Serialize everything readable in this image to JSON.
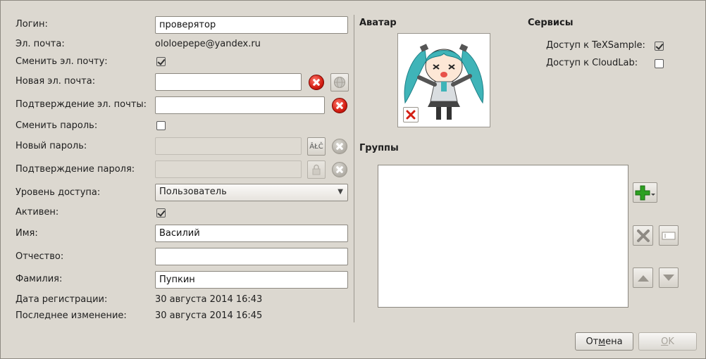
{
  "form": {
    "login": {
      "label": "Логин:",
      "value": "проверятор"
    },
    "email": {
      "label": "Эл. почта:",
      "value": "ololoepepe@yandex.ru"
    },
    "change_email": {
      "label": "Сменить эл. почту:",
      "checked": true
    },
    "new_email": {
      "label": "Новая эл. почта:",
      "value": ""
    },
    "confirm_email": {
      "label": "Подтверждение эл. почты:",
      "value": ""
    },
    "change_password": {
      "label": "Сменить пароль:",
      "checked": false
    },
    "new_password": {
      "label": "Новый пароль:",
      "value": ""
    },
    "confirm_password": {
      "label": "Подтверждение пароля:",
      "value": ""
    },
    "access_level": {
      "label": "Уровень доступа:",
      "value": "Пользователь"
    },
    "active": {
      "label": "Активен:",
      "checked": true
    },
    "first_name": {
      "label": "Имя:",
      "value": "Василий"
    },
    "patronymic": {
      "label": "Отчество:",
      "value": ""
    },
    "last_name": {
      "label": "Фамилия:",
      "value": "Пупкин"
    },
    "registration_date": {
      "label": "Дата регистрации:",
      "value": "30 августа 2014 16:43"
    },
    "last_modified": {
      "label": "Последнее изменение:",
      "value": "30 августа 2014 16:45"
    }
  },
  "avatar": {
    "heading": "Аватар"
  },
  "services": {
    "heading": "Сервисы",
    "items": [
      {
        "label": "Доступ к TeXSample:",
        "checked": true
      },
      {
        "label": "Доступ к CloudLab:",
        "checked": false
      }
    ]
  },
  "groups": {
    "heading": "Группы",
    "items": []
  },
  "password_keyboard_icon_text": "ÂŁČ",
  "buttons": {
    "cancel_pre": "От",
    "cancel_mnemonic": "м",
    "cancel_post": "ена",
    "ok_mnemonic": "O",
    "ok_post": "K"
  },
  "colors": {
    "window_bg": "#dcd8d0",
    "accent_red": "#d41e12",
    "add_green": "#2da021"
  }
}
